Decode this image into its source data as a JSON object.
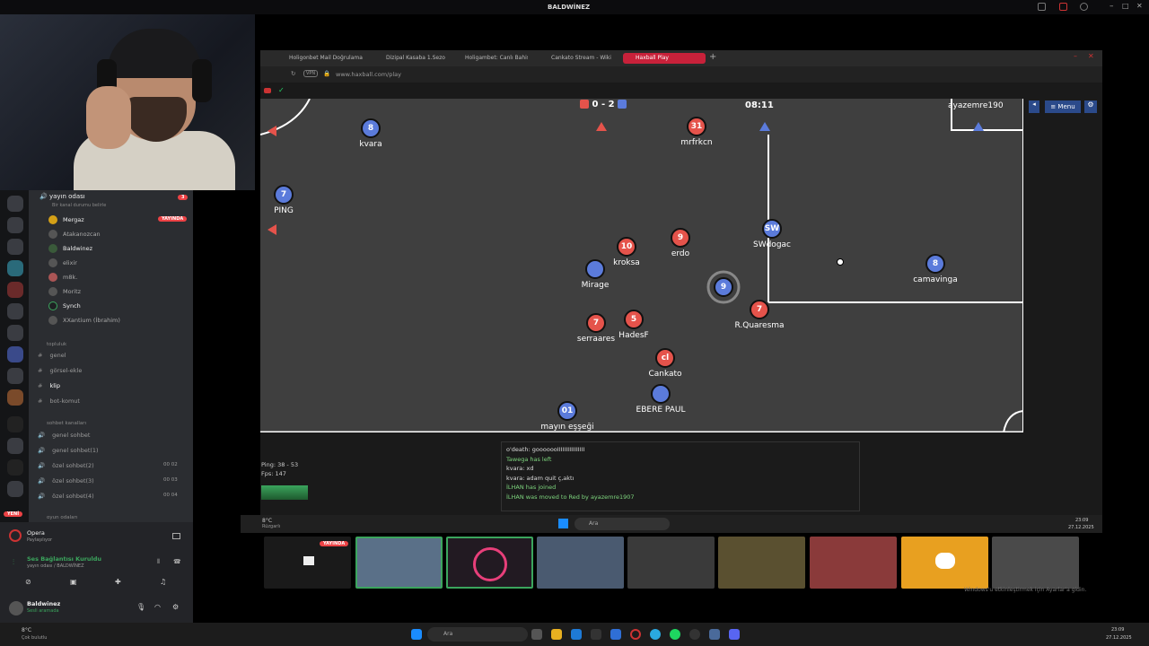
{
  "window": {
    "title": "BALDWİNEZ"
  },
  "tabs": [
    {
      "label": "Holigonbet Mail Doğrulama"
    },
    {
      "label": "Dizipal Kasaba 1.Sezon 8."
    },
    {
      "label": "Holigambet: Canlı Bahis ve"
    },
    {
      "label": "Cankato Stream - Wiki"
    },
    {
      "label": "Haxball Play"
    }
  ],
  "address": {
    "vpn": "VPN",
    "url": "www.haxball.com/play"
  },
  "game": {
    "score_red": "0",
    "score_sep": "-",
    "score_blue": "2",
    "timer": "08:11",
    "menu_label": "≡ Menu",
    "top_player": "ayazemre190",
    "players": [
      {
        "num": "8",
        "name": "kvara",
        "team": "blue"
      },
      {
        "num": "31",
        "name": "mrfrkcn",
        "team": "red"
      },
      {
        "num": "7",
        "name": "PING",
        "team": "blue"
      },
      {
        "num": "SW",
        "name": "SWdogac",
        "team": "blue"
      },
      {
        "num": "10",
        "name": "kroksa",
        "team": "red"
      },
      {
        "num": "9",
        "name": "erdo",
        "team": "red"
      },
      {
        "num": "",
        "name": "Mirage",
        "team": "blue"
      },
      {
        "num": "9",
        "name": "",
        "team": "blue"
      },
      {
        "num": "8",
        "name": "camavinga",
        "team": "blue"
      },
      {
        "num": "7",
        "name": "R.Quaresma",
        "team": "red"
      },
      {
        "num": "7",
        "name": "serraares",
        "team": "red"
      },
      {
        "num": "5",
        "name": "HadesF",
        "team": "red"
      },
      {
        "num": "cl",
        "name": "Cankato",
        "team": "red"
      },
      {
        "num": "",
        "name": "EBERE PAUL",
        "team": "blue"
      },
      {
        "num": "01",
        "name": "mayın eşşeği",
        "team": "blue"
      }
    ]
  },
  "chat": [
    {
      "text": "o'death: gooooooIIIIIIIIIIIIIIII",
      "sys": false
    },
    {
      "text": "Tawega has left",
      "sys": true
    },
    {
      "text": "kvara: xd",
      "sys": false
    },
    {
      "text": "kvara: adam quit ç,aktı",
      "sys": false
    },
    {
      "text": "İLHAN has joined",
      "sys": true
    },
    {
      "text": "İLHAN was moved to Red by ayazemre1907",
      "sys": true
    }
  ],
  "stats": {
    "ping": "Ping: 38 - 53",
    "fps": "Fps: 147"
  },
  "discord": {
    "voice_channel": "yayın odası",
    "voice_sub": "Bir kanal durumu belirle",
    "voice_badge": "3",
    "live_badge": "YAYINDA",
    "users": [
      "Mergaz",
      "Atakanozcan",
      "Baldwinez",
      "elixir",
      "m8k.",
      "Moritz",
      "Synch",
      "XXantium (İbrahim)"
    ],
    "cat_topluluk": "topluluk",
    "text_channels": [
      "genel",
      "görsel-ekle",
      "klip",
      "bot-komut"
    ],
    "cat_sohbet": "sohbet kanalları",
    "voice_channels": [
      {
        "name": "genel sohbet",
        "count": ""
      },
      {
        "name": "genel sohbet(1)",
        "count": ""
      },
      {
        "name": "özel sohbet(2)",
        "count": "00 02"
      },
      {
        "name": "özel sohbet(3)",
        "count": "00 03"
      },
      {
        "name": "özel sohbet(4)",
        "count": "00 04"
      }
    ],
    "cat_oyun": "oyun odaları",
    "new_badge": "YENİ",
    "opera": "Opera",
    "opera_sub": "Paylaşılıyor",
    "voice_connected": "Ses Bağlantısı Kuruldu",
    "voice_connected_sub": "yayın odası / BALDWİNEZ",
    "me_name": "Baldwinez",
    "me_status": "Sesli aramada"
  },
  "weather": {
    "temp": "8°C",
    "desc": "Rüzgarlı"
  },
  "weather2": {
    "temp": "8°C",
    "desc": "Çok bulutlu"
  },
  "search": {
    "placeholder": "Ara"
  },
  "clock": {
    "time": "23:09",
    "date": "27.12.2025"
  },
  "watermark": "Windows'u etkinleştirmek için Ayarlar'a gidin.",
  "thumb_live": "YAYINDA",
  "colors": {
    "red_team": "#e5534b",
    "blue_team": "#5b7bdb",
    "accent": "#c8213a"
  }
}
